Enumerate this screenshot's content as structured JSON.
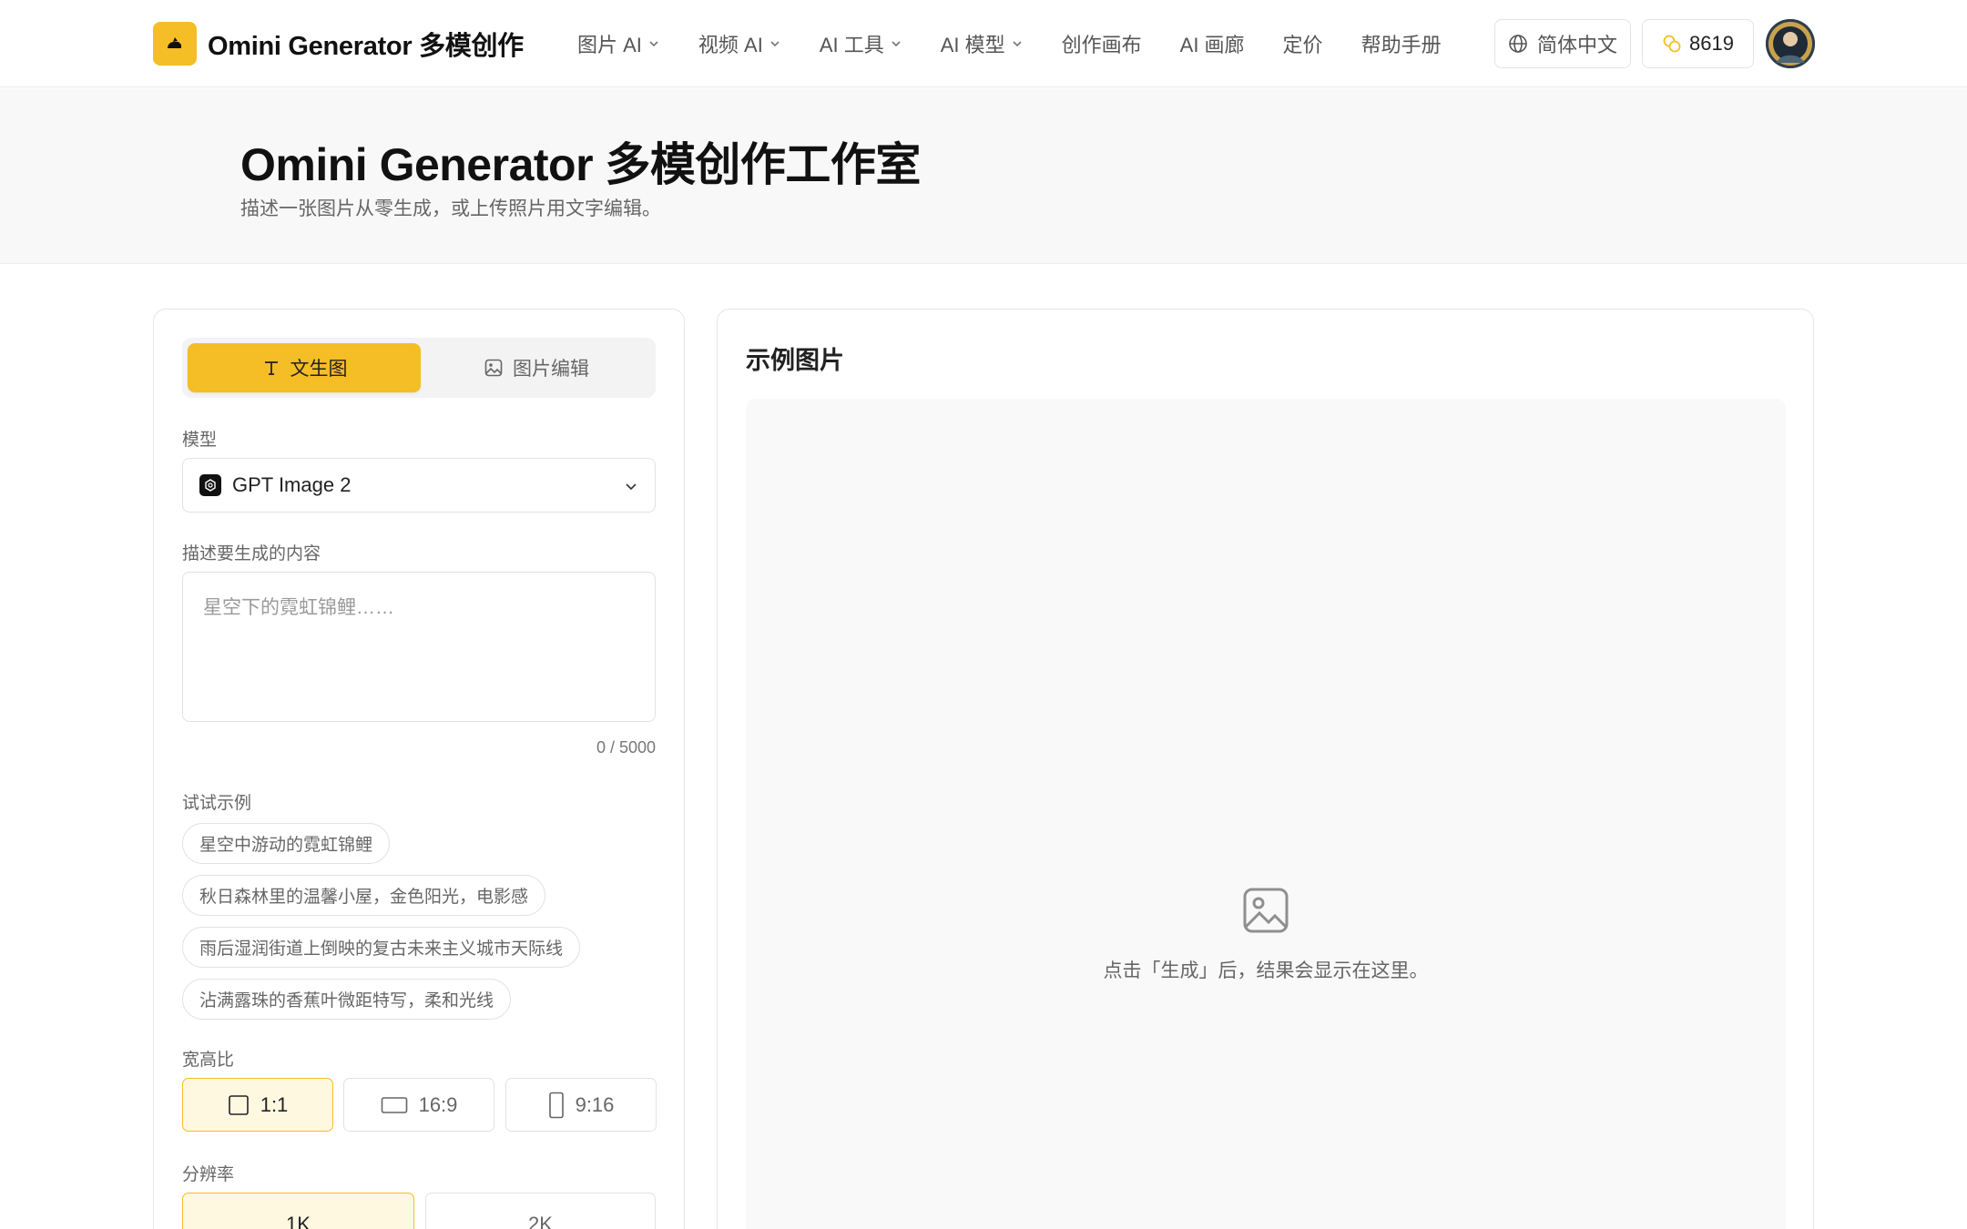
{
  "header": {
    "brand": "Omini Generator 多模创作",
    "nav": [
      {
        "label": "图片 AI",
        "dropdown": true
      },
      {
        "label": "视频 AI",
        "dropdown": true
      },
      {
        "label": "AI 工具",
        "dropdown": true
      },
      {
        "label": "AI 模型",
        "dropdown": true
      },
      {
        "label": "创作画布",
        "dropdown": false
      },
      {
        "label": "AI 画廊",
        "dropdown": false
      },
      {
        "label": "定价",
        "dropdown": false
      },
      {
        "label": "帮助手册",
        "dropdown": false
      }
    ],
    "language": "简体中文",
    "credits": "8619"
  },
  "hero": {
    "title": "Omini Generator 多模创作工作室",
    "subtitle": "描述一张图片从零生成，或上传照片用文字编辑。"
  },
  "form": {
    "tabs": {
      "text_to_image": "文生图",
      "image_edit": "图片编辑"
    },
    "model_label": "模型",
    "model_value": "GPT Image 2",
    "prompt_label": "描述要生成的内容",
    "prompt_placeholder": "星空下的霓虹锦鲤……",
    "counter": "0 / 5000",
    "examples_label": "试试示例",
    "examples": [
      "星空中游动的霓虹锦鲤",
      "秋日森林里的温馨小屋，金色阳光，电影感",
      "雨后湿润街道上倒映的复古未来主义城市天际线",
      "沾满露珠的香蕉叶微距特写，柔和光线"
    ],
    "aspect_label": "宽高比",
    "aspect_options": [
      "1:1",
      "16:9",
      "9:16"
    ],
    "aspect_selected": "1:1",
    "resolution_label": "分辨率",
    "resolution_options": [
      "1K",
      "2K"
    ],
    "resolution_selected": "1K"
  },
  "preview": {
    "title": "示例图片",
    "empty_text": "点击「生成」后，结果会显示在这里。"
  },
  "colors": {
    "accent": "#f5bd26",
    "accent_light": "#fff8e1"
  }
}
